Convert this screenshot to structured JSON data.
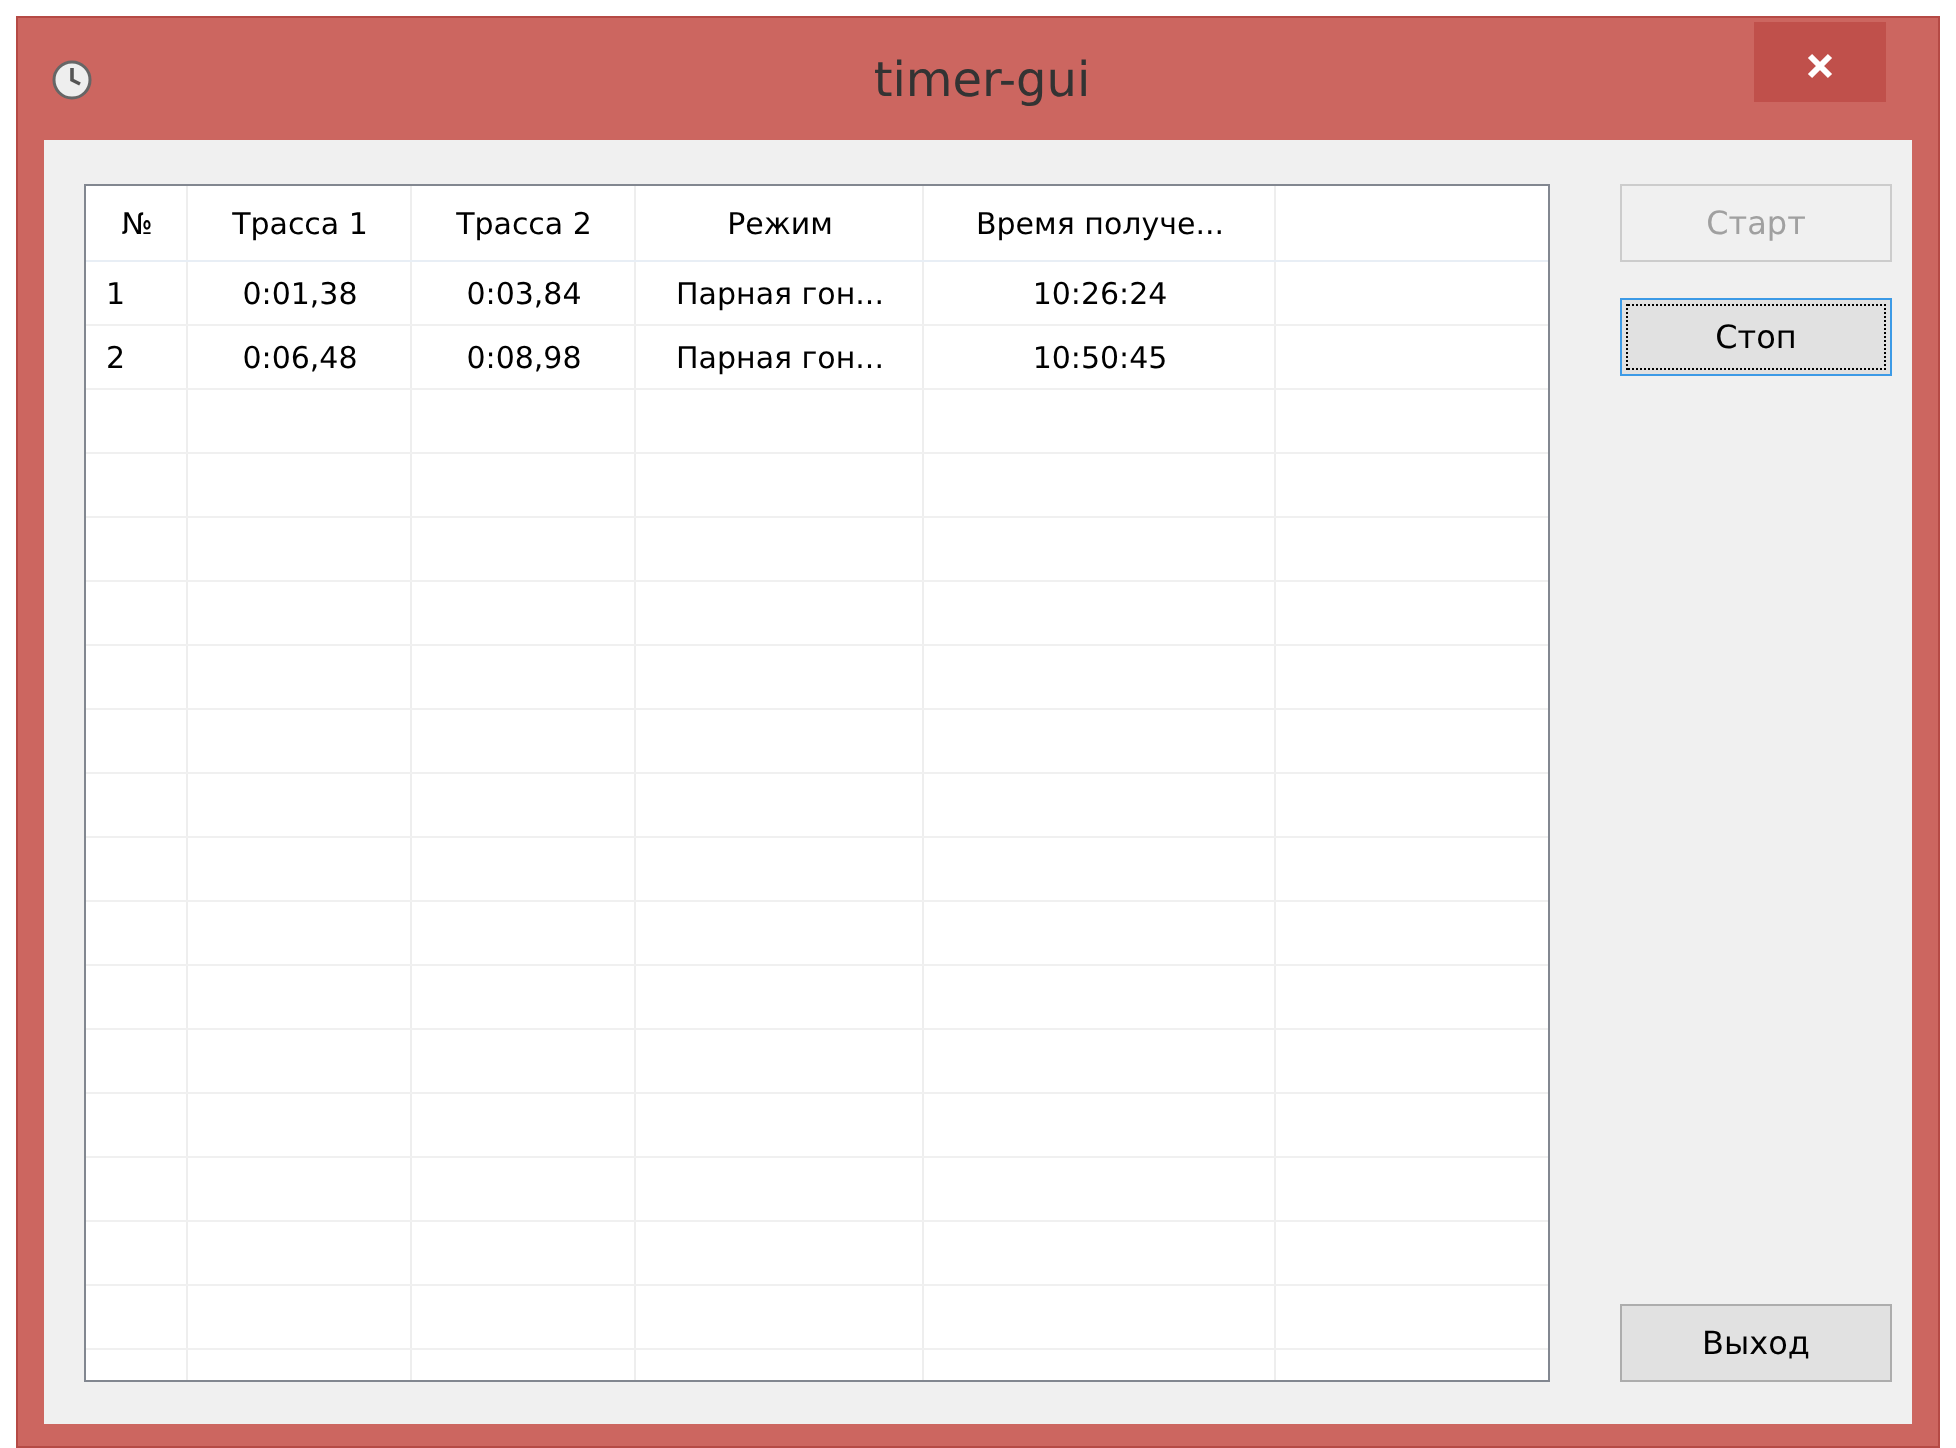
{
  "window": {
    "title": "timer-gui"
  },
  "table": {
    "columns": [
      "№",
      "Трасса 1",
      "Трасса 2",
      "Режим",
      "Время получе..."
    ],
    "rows": [
      {
        "cells": [
          "1",
          "0:01,38",
          "0:03,84",
          "Парная гон...",
          "10:26:24"
        ]
      },
      {
        "cells": [
          "2",
          "0:06,48",
          "0:08,98",
          "Парная гон...",
          "10:50:45"
        ]
      }
    ]
  },
  "buttons": [
    {
      "label": "Старт",
      "disabled": true,
      "focused": false
    },
    {
      "label": "Стоп",
      "disabled": false,
      "focused": true
    },
    {
      "label": "Выход",
      "disabled": false,
      "focused": false
    }
  ]
}
